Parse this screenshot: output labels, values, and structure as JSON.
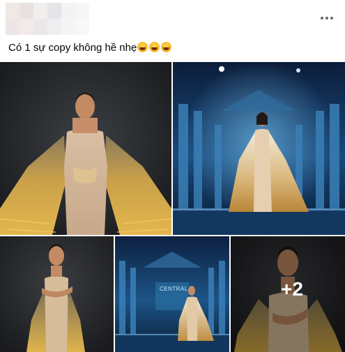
{
  "post": {
    "caption": "Có 1 sự copy không hề nhẹ",
    "caption_emojis": [
      "rolling-on-floor-laughing-emoji",
      "rolling-on-floor-laughing-emoji",
      "rolling-on-floor-laughing-emoji"
    ],
    "more_icon": "more-horizontal-icon",
    "extra_photos_label": "+2",
    "stage_sign_text": "CENTRAL"
  },
  "colors": {
    "caption_text": "#050505",
    "icon_gray": "#65676b",
    "overlay": "rgba(0,0,0,0.38)"
  }
}
